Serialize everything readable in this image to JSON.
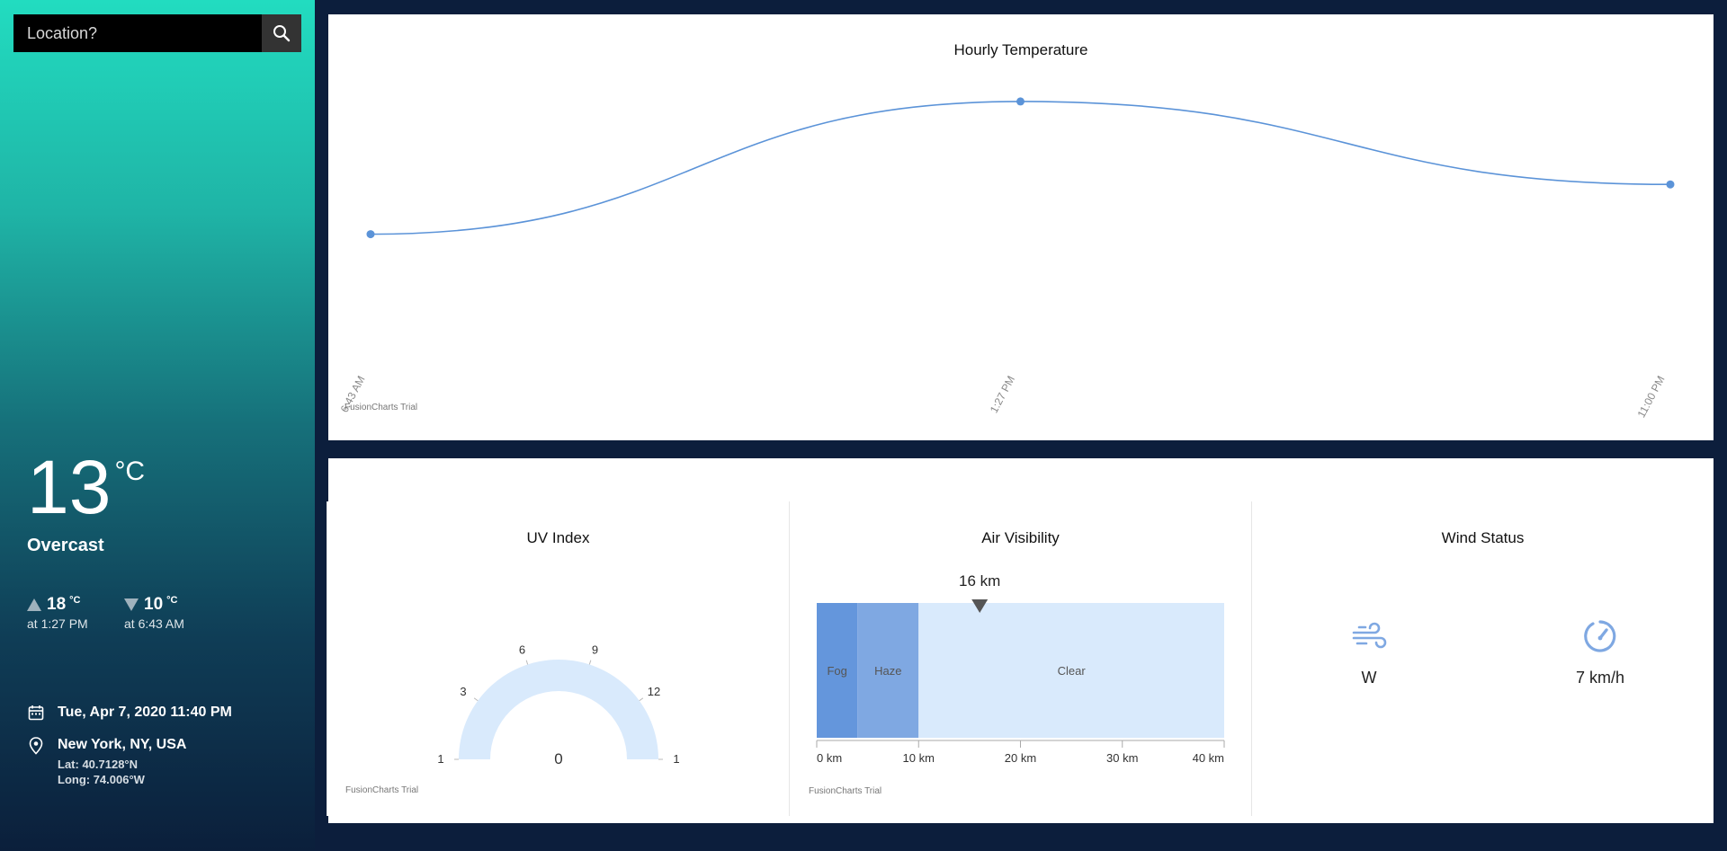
{
  "search": {
    "placeholder": "Location?"
  },
  "current": {
    "temp": "13",
    "unit": "°C",
    "condition": "Overcast",
    "max_temp": "18",
    "max_unit": "°C",
    "max_time": "at 1:27 PM",
    "min_temp": "10",
    "min_unit": "°C",
    "min_time": "at 6:43 AM"
  },
  "datetime": "Tue, Apr 7, 2020 11:40 PM",
  "location": {
    "name": "New York, NY, USA",
    "lat": "Lat: 40.7128°N",
    "long": "Long: 74.006°W"
  },
  "trial_label": "FusionCharts Trial",
  "chart_data": [
    {
      "type": "line",
      "title": "Hourly Temperature",
      "categories": [
        "6:43 AM",
        "1:27 PM",
        "11:00 PM"
      ],
      "values": [
        10,
        18,
        13
      ],
      "xlabel": "",
      "ylabel": ""
    },
    {
      "type": "gauge",
      "title": "UV Index",
      "value": 0,
      "value_label": "0",
      "range": [
        0,
        15
      ],
      "tick_labels": [
        "1",
        "3",
        "6",
        "9",
        "12",
        "1"
      ]
    },
    {
      "type": "bar",
      "title": "Air Visibility",
      "value": 16,
      "value_label": "16 km",
      "range": [
        0,
        40
      ],
      "bands": [
        {
          "label": "Fog",
          "from": 0,
          "to": 4,
          "color": "#6496dc"
        },
        {
          "label": "Haze",
          "from": 4,
          "to": 10,
          "color": "#7fa8e2"
        },
        {
          "label": "Clear",
          "from": 10,
          "to": 40,
          "color": "#d9eafc"
        }
      ],
      "tick_labels": [
        "0 km",
        "10 km",
        "20 km",
        "30 km",
        "40 km"
      ],
      "ticks": [
        0,
        10,
        20,
        30,
        40
      ]
    }
  ],
  "wind": {
    "title": "Wind Status",
    "direction": "W",
    "speed": "7 km/h"
  },
  "colors": {
    "line": "#5b93d8",
    "gauge": "#d9eafc",
    "icon": "#7fa8e2"
  }
}
